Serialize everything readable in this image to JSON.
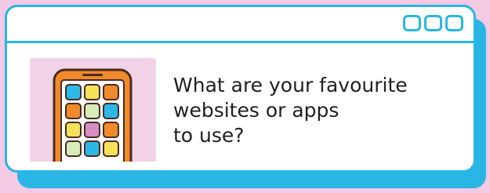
{
  "colors": {
    "background": "#F4C9E3",
    "accent": "#29B6E4",
    "card": "#FFFFFF",
    "illustration_bg": "#F2D2E6",
    "phone_frame": "#F08A2A",
    "text": "#1F1F1F"
  },
  "window": {
    "controls": [
      "window-control-icon",
      "window-control-icon",
      "window-control-icon"
    ]
  },
  "illustration": {
    "icon": "smartphone-apps-icon",
    "app_tile_colors": [
      [
        "#2CB8E6",
        "#F5E15A",
        "#F08A2A"
      ],
      [
        "#F08A2A",
        "#D7EDB9",
        "#2CB8E6"
      ],
      [
        "#F5E15A",
        "#D68FC3",
        "#F08A2A"
      ],
      [
        "#D7EDB9",
        "#2CB8E6",
        "#F5E15A"
      ]
    ]
  },
  "prompt": {
    "lines": [
      "What are your favourite",
      "websites or apps",
      "to use?"
    ]
  }
}
